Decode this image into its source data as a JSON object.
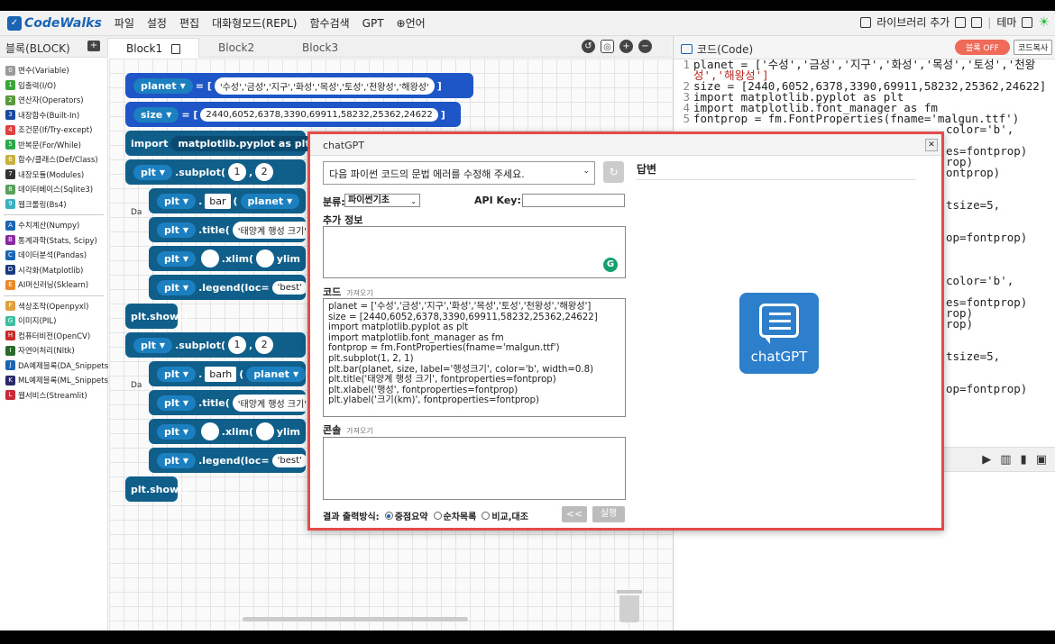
{
  "app": {
    "logo_text": "CodeWalks",
    "menu": [
      "파일",
      "설정",
      "편집",
      "대화형모드(REPL)",
      "함수검색",
      "GPT",
      "⊕언어"
    ],
    "library_add": "라이브러리 추가",
    "theme_label": "테마"
  },
  "block_panel": {
    "label": "블록(BLOCK)",
    "tabs": [
      "Block1",
      "Block2",
      "Block3"
    ],
    "active_tab": "Block1"
  },
  "categories": [
    {
      "num": "0",
      "label": "변수(Variable)",
      "color": "#9a9a9a"
    },
    {
      "num": "1",
      "label": "입출력(I/O)",
      "color": "#3aa63a"
    },
    {
      "num": "2",
      "label": "연산자(Operators)",
      "color": "#5a9a3a"
    },
    {
      "num": "3",
      "label": "내장함수(Built-In)",
      "color": "#1a4aa0"
    },
    {
      "num": "4",
      "label": "조건문(If/Try-except)",
      "color": "#e04040"
    },
    {
      "num": "5",
      "label": "반복문(For/While)",
      "color": "#2aa84a"
    },
    {
      "num": "6",
      "label": "함수/클래스(Def/Class)",
      "color": "#c8b040"
    },
    {
      "num": "7",
      "label": "내장모듈(Modules)",
      "color": "#333333"
    },
    {
      "num": "8",
      "label": "데이터베이스(Sqlite3)",
      "color": "#5aa05a"
    },
    {
      "num": "9",
      "label": "웹크롤링(Bs4)",
      "color": "#3ab0c0"
    },
    {
      "num": "A",
      "label": "수치계산(Numpy)",
      "color": "#1a64b4"
    },
    {
      "num": "B",
      "label": "통계과학(Stats, Scipy)",
      "color": "#8a2aa0"
    },
    {
      "num": "C",
      "label": "데이터분석(Pandas)",
      "color": "#1a64b4"
    },
    {
      "num": "D",
      "label": "시각화(Matplotlib)",
      "color": "#1a3a80"
    },
    {
      "num": "E",
      "label": "AI머신러닝(Sklearn)",
      "color": "#e88a2a"
    },
    {
      "num": "F",
      "label": "색상조작(Openpyxl)",
      "color": "#e0a040"
    },
    {
      "num": "G",
      "label": "이미지(PIL)",
      "color": "#3ac0a0"
    },
    {
      "num": "H",
      "label": "컴퓨터비전(OpenCV)",
      "color": "#c82a2a"
    },
    {
      "num": "I",
      "label": "자연어처리(Nltk)",
      "color": "#2a6a2a"
    },
    {
      "num": "J",
      "label": "DA예제블록(DA_Snippets)",
      "color": "#1a64b4"
    },
    {
      "num": "K",
      "label": "ML예제블록(ML_Snippets)",
      "color": "#2a2a6a"
    },
    {
      "num": "L",
      "label": "웹서비스(Streamlit)",
      "color": "#c82a3a"
    }
  ],
  "blocks": {
    "var_planet": "planet",
    "planet_list": "'수성','금성','지구','화성','목성','토성','천왕성','해왕성'",
    "var_size": "size",
    "size_list": "2440,6052,6378,3390,69911,58232,25362,24622",
    "import_kw": "import",
    "import_mod": "matplotlib.pyplot as plt",
    "plt": "plt",
    "subplot": ".subplot(",
    "sub1": "1",
    "sub2": "2",
    "bar_method": "bar",
    "barh_method": "barh",
    "planet_ref": "planet",
    "title_fn": ".title(",
    "title_val": "'태양계 행성 크기'",
    "xlim_fn": ".xlim(",
    "ylim_fn": "ylim",
    "legend_fn": ".legend(loc=",
    "legend_val": "'best'",
    "show": "plt.show()",
    "dot": ".",
    "label_da": "Da"
  },
  "code_panel": {
    "title": "코드(Code)",
    "block_off": "블록 OFF",
    "copy": "코드복사",
    "lines": [
      {
        "n": "1",
        "t": "planet = ['수성','금성','지구','화성','목성','토성','천왕"
      },
      {
        "n": "",
        "t": "성','해왕성']"
      },
      {
        "n": "2",
        "t": "size = [2440,6052,6378,3390,69911,58232,25362,24622]"
      },
      {
        "n": "3",
        "t": "import matplotlib.pyplot as plt"
      },
      {
        "n": "4",
        "t": "import matplotlib.font_manager as fm"
      },
      {
        "n": "5",
        "t": "fontprop = fm.FontProperties(fname='malgun.ttf')"
      }
    ],
    "fragments": [
      "color='b',",
      "es=fontprop)",
      "rop)",
      "ontprop)",
      "tsize=5,",
      "op=fontprop)",
      "color='b',",
      "es=fontprop)",
      "rop)",
      "rop)",
      "tsize=5,",
      "op=fontprop)"
    ]
  },
  "dialog": {
    "title": "chatGPT",
    "prompt": "다음 파이썬 코드의 문법 에러를 수정해 주세요.",
    "category_label": "분류:",
    "category_value": "파이썬기초",
    "api_key_label": "API Key:",
    "extra_label": "추가 정보",
    "code_label": "코드",
    "load": "가져오기",
    "code_lines": [
      "planet = ['수성','금성','지구','화성','목성','토성','천왕성','해왕성']",
      "size = [2440,6052,6378,3390,69911,58232,25362,24622]",
      "import matplotlib.pyplot as plt",
      "import matplotlib.font_manager as fm",
      "fontprop = fm.FontProperties(fname='malgun.ttf')",
      "plt.subplot(1, 2, 1)",
      "plt.bar(planet, size, label='행성크기', color='b', width=0.8)",
      "plt.title('태양계 행성 크기', fontproperties=fontprop)",
      "plt.xlabel('행성', fontproperties=fontprop)",
      "plt.ylabel('크기(km)', fontproperties=fontprop)"
    ],
    "console_label": "콘솔",
    "result_label": "결과 출력방식:",
    "options": [
      "중점요약",
      "순차목록",
      "비교,대조"
    ],
    "back": "<<",
    "run": "실행",
    "answer_label": "답변",
    "logo_text": "chatGPT"
  }
}
